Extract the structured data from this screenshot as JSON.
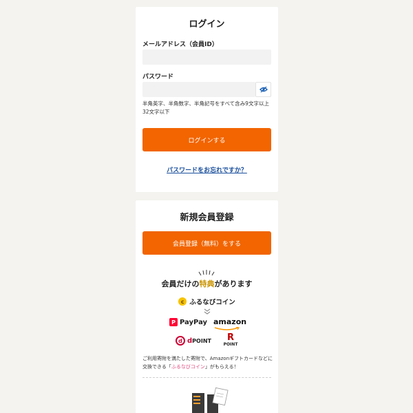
{
  "login": {
    "title": "ログイン",
    "email_label": "メールアドレス（会員ID）",
    "email_value": "",
    "password_label": "パスワード",
    "password_value": "",
    "password_hint": "半角英字、半角数字、半角記号をすべて含み9文字以上32文字以下",
    "login_button": "ログインする",
    "forgot_link": "パスワードをお忘れですか？"
  },
  "register": {
    "title": "新規会員登録",
    "register_button": "会員登録（無料）をする",
    "benefit_title_pre": "会員だけの",
    "benefit_title_highlight": "特典",
    "benefit_title_post": "があります",
    "coin_label": "ふるなびコイン",
    "partners": {
      "paypay": "PayPay",
      "amazon": "amazon",
      "dpoint": "POINT",
      "rpoint": "POINT"
    },
    "note_pre": "ご利用寄附を満たした寄附で、Amazonギフトカードなどに交換できる「",
    "note_highlight": "ふるなびコイン",
    "note_post": "」がもらえる！"
  },
  "colors": {
    "accent": "#f26500",
    "link": "#1a4f9c",
    "highlight": "#c99300",
    "background": "#f4f3ef"
  },
  "icons": [
    "eye-icon",
    "coin-icon",
    "chevron-down-icon",
    "paypay-icon",
    "dpoint-icon",
    "rakuten-icon"
  ]
}
